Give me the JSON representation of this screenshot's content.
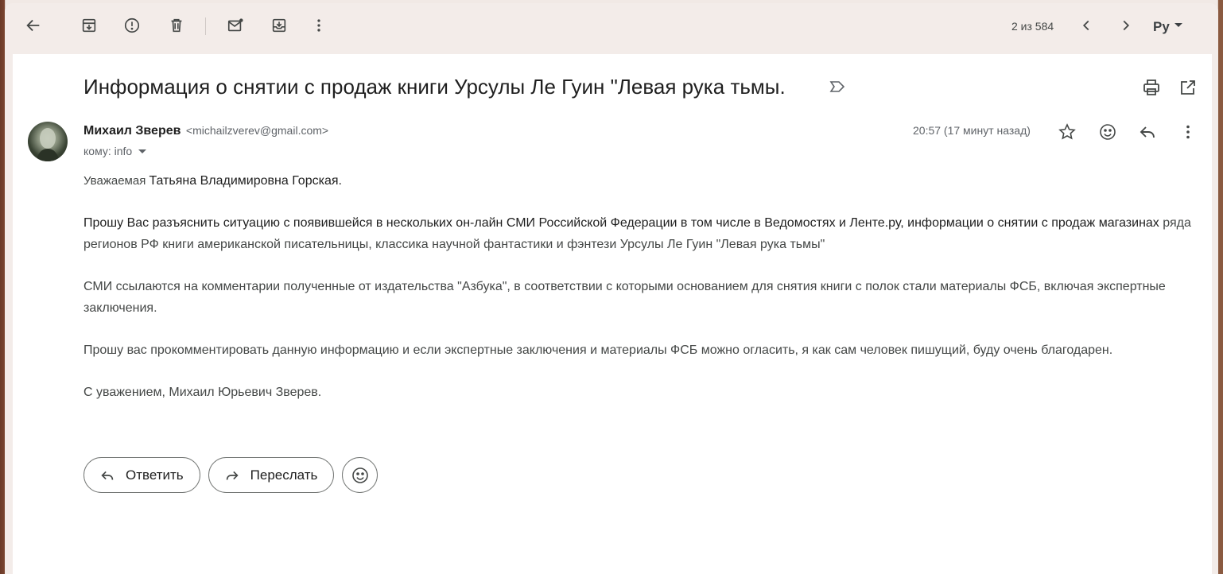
{
  "toolbar": {
    "icons": [
      "back-arrow-icon",
      "archive-icon",
      "report-spam-icon",
      "delete-icon",
      "mark-unread-icon",
      "move-to-icon",
      "more-vert-icon"
    ],
    "pager": "2 из 584",
    "language": "Ру"
  },
  "message": {
    "subject": "Информация о снятии с продаж книги Урсулы Ле Гуин \"Левая рука тьмы.",
    "sender_name": "Михаил Зверев",
    "sender_email": "<michailzverev@gmail.com>",
    "to": "кому: info",
    "time": "20:57 (17 минут назад)",
    "salutation_prefix": "Уважаемая ",
    "salutation_name": "Татьяна Владимировна Горская.",
    "paragraph1_dark": "Прошу Вас разъяснить ситуацию с появившейся в нескольких он-лайн СМИ Российской Федерации в том числе в Ведомостях и Ленте.ру, информации о снятии с продаж магазинах",
    "paragraph1_rest": " ряда регионов РФ книги американской писательницы, классика научной фантастики и фэнтези Урсулы Ле Гуин \"Левая рука тьмы\"",
    "paragraph2": "СМИ ссылаются на комментарии полученные от издательства \"Азбука\", в соответствии с которыми основанием для снятия книги с полок стали материалы ФСБ, включая экспертные заключения.",
    "paragraph3": "Прошу вас прокомментировать данную информацию и если экспертные заключения и материалы ФСБ можно огласить, я как сам человек пишущий, буду очень благодарен.",
    "signature": "С уважением, Михаил Юрьевич Зверев."
  },
  "actions": {
    "reply_label": "Ответить",
    "forward_label": "Переслать"
  }
}
